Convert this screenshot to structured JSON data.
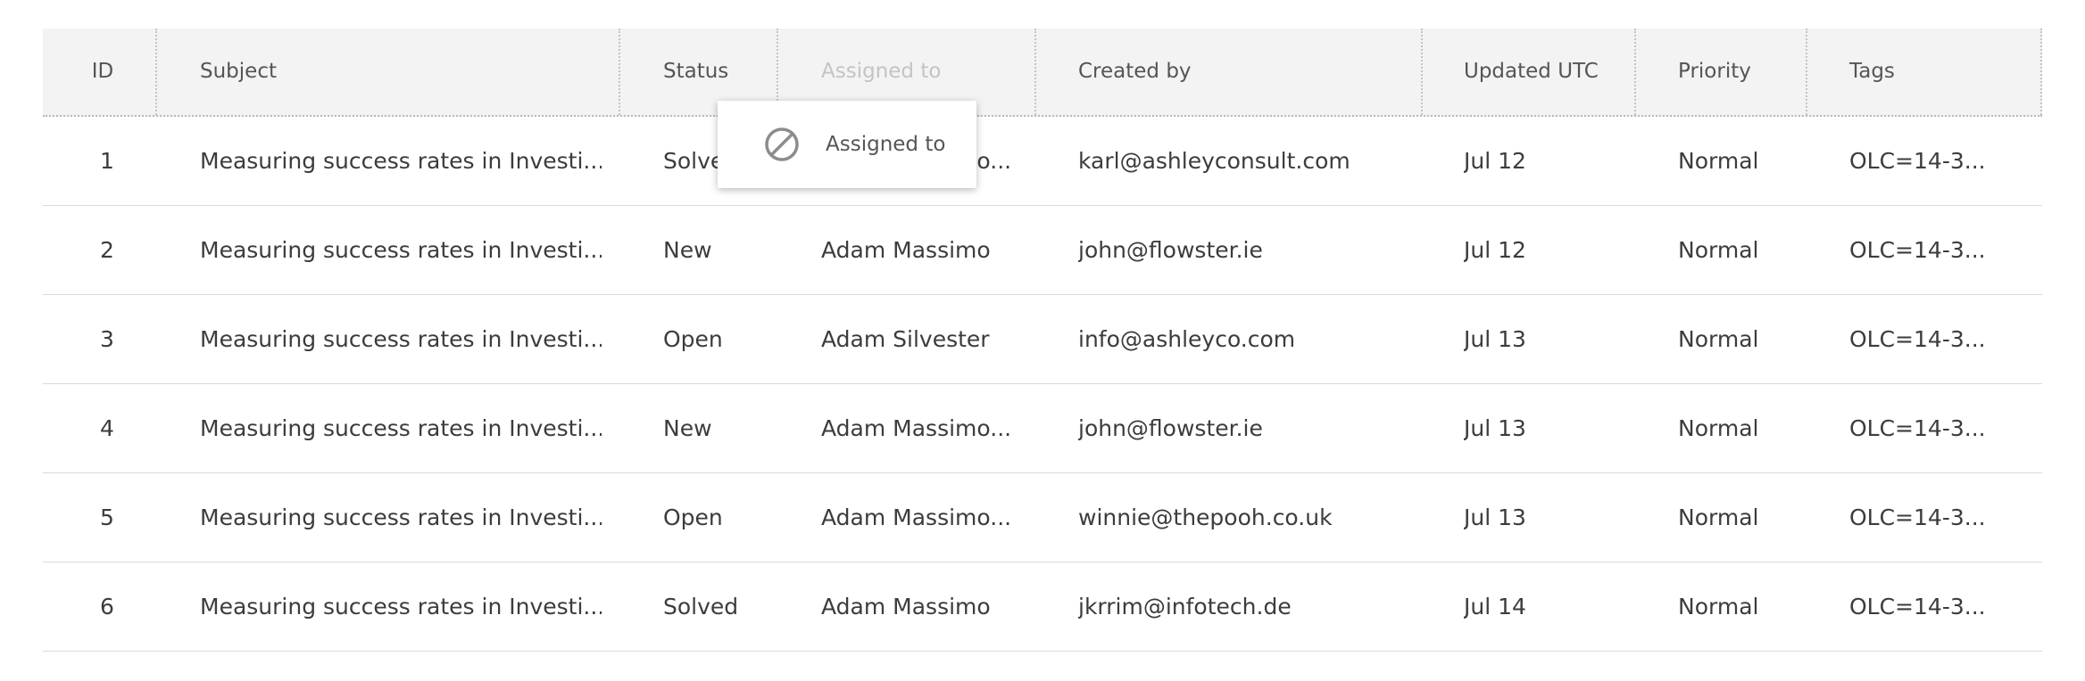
{
  "grid": {
    "columns": [
      {
        "key": "id",
        "label": "ID"
      },
      {
        "key": "subject",
        "label": "Subject"
      },
      {
        "key": "status",
        "label": "Status"
      },
      {
        "key": "assigned",
        "label": "Assigned to"
      },
      {
        "key": "created_by",
        "label": "Created by"
      },
      {
        "key": "updated",
        "label": "Updated UTC"
      },
      {
        "key": "priority",
        "label": "Priority"
      },
      {
        "key": "tags",
        "label": "Tags"
      }
    ],
    "rows": [
      {
        "id": "1",
        "subject": "Measuring success rates in Investi...",
        "status": "Solved",
        "assigned": "Adam Massimo...",
        "created_by": "karl@ashleyconsult.com",
        "updated": "Jul 12",
        "priority": "Normal",
        "tags": "OLC=14-3..."
      },
      {
        "id": "2",
        "subject": "Measuring success rates in Investi...",
        "status": "New",
        "assigned": "Adam Massimo",
        "created_by": "john@flowster.ie",
        "updated": "Jul 12",
        "priority": "Normal",
        "tags": "OLC=14-3..."
      },
      {
        "id": "3",
        "subject": "Measuring success rates in Investi...",
        "status": "Open",
        "assigned": "Adam Silvester",
        "created_by": "info@ashleyco.com",
        "updated": "Jul 13",
        "priority": "Normal",
        "tags": "OLC=14-3..."
      },
      {
        "id": "4",
        "subject": "Measuring success rates in Investi...",
        "status": "New",
        "assigned": "Adam Massimo...",
        "created_by": "john@flowster.ie",
        "updated": "Jul 13",
        "priority": "Normal",
        "tags": "OLC=14-3..."
      },
      {
        "id": "5",
        "subject": "Measuring success rates in Investi...",
        "status": "Open",
        "assigned": "Adam Massimo...",
        "created_by": "winnie@thepooh.co.uk",
        "updated": "Jul 13",
        "priority": "Normal",
        "tags": "OLC=14-3..."
      },
      {
        "id": "6",
        "subject": "Measuring success rates in Investi...",
        "status": "Solved",
        "assigned": "Adam Massimo",
        "created_by": "jkrrim@infotech.de",
        "updated": "Jul 14",
        "priority": "Normal",
        "tags": "OLC=14-3..."
      }
    ]
  },
  "drag_popup": {
    "label": "Assigned to",
    "icon": "not-allowed-icon"
  }
}
